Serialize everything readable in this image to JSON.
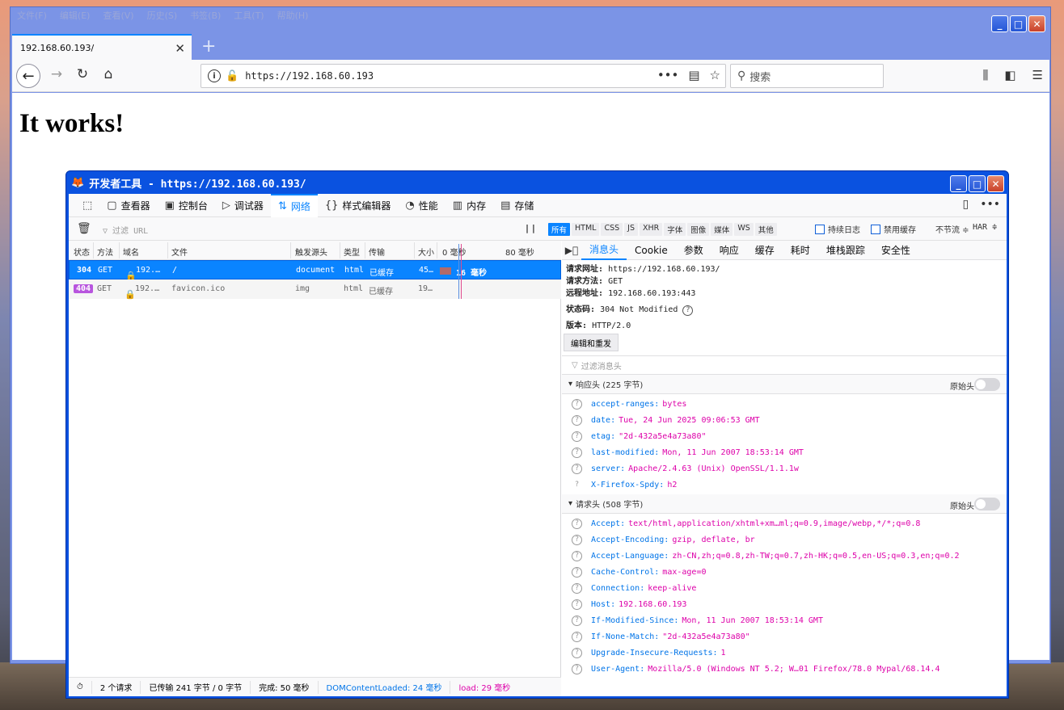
{
  "browser": {
    "menu": [
      "文件(F)",
      "编辑(E)",
      "查看(V)",
      "历史(S)",
      "书签(B)",
      "工具(T)",
      "帮助(H)"
    ],
    "tab_title": "192.168.60.193/",
    "url": "https://192.168.60.193",
    "search_placeholder": "搜索",
    "page_heading": "It works!"
  },
  "devtools": {
    "title": "开发者工具 - https://192.168.60.193/",
    "tabs": [
      {
        "label": "查看器",
        "icon": "inspector-icon"
      },
      {
        "label": "控制台",
        "icon": "console-icon"
      },
      {
        "label": "调试器",
        "icon": "debugger-icon"
      },
      {
        "label": "网络",
        "icon": "network-icon",
        "active": true
      },
      {
        "label": "样式编辑器",
        "icon": "style-editor-icon"
      },
      {
        "label": "性能",
        "icon": "performance-icon"
      },
      {
        "label": "内存",
        "icon": "memory-icon"
      },
      {
        "label": "存储",
        "icon": "storage-icon"
      }
    ],
    "filter_url": "过滤 URL",
    "type_filters": [
      "所有",
      "HTML",
      "CSS",
      "JS",
      "XHR",
      "字体",
      "图像",
      "媒体",
      "WS",
      "其他"
    ],
    "persist_log": "持续日志",
    "disable_cache": "禁用缓存",
    "throttle": "不节流 ≑",
    "har": "HAR ≑",
    "columns": [
      "状态",
      "方法",
      "域名",
      "文件",
      "触发源头",
      "类型",
      "传输",
      "大小",
      "0 毫秒",
      "80 毫秒"
    ],
    "requests": [
      {
        "status": "304",
        "method": "GET",
        "domain": "192.…",
        "file": "/",
        "cause": "document",
        "type": "html",
        "transferred": "已缓存",
        "size": "45…",
        "timing": "16 毫秒"
      },
      {
        "status": "404",
        "method": "GET",
        "domain": "192.…",
        "file": "favicon.ico",
        "cause": "img",
        "type": "html",
        "transferred": "已缓存",
        "size": "19…",
        "timing": ""
      }
    ],
    "status_bar": {
      "requests": "2 个请求",
      "transferred": "已传输 241 字节 / 0 字节",
      "finish": "完成: 50 毫秒",
      "dcl": "DOMContentLoaded: 24 毫秒",
      "load": "load: 29 毫秒"
    },
    "detail_tabs": [
      "消息头",
      "Cookie",
      "参数",
      "响应",
      "缓存",
      "耗时",
      "堆栈跟踪",
      "安全性"
    ],
    "summary": {
      "url_label": "请求网址:",
      "url": "https://192.168.60.193/",
      "method_label": "请求方法:",
      "method": "GET",
      "remote_label": "远程地址:",
      "remote": "192.168.60.193:443",
      "status_label": "状态码:",
      "status": "304 Not Modified",
      "version_label": "版本:",
      "version": "HTTP/2.0"
    },
    "resend_button": "编辑和重发",
    "filter_headers": "过滤消息头",
    "raw_label": "原始头",
    "response_headers_title": "响应头 (225 字节)",
    "response_headers": [
      {
        "k": "accept-ranges:",
        "v": "bytes"
      },
      {
        "k": "date:",
        "v": "Tue, 24 Jun 2025 09:06:53 GMT"
      },
      {
        "k": "etag:",
        "v": "\"2d-432a5e4a73a80\""
      },
      {
        "k": "last-modified:",
        "v": "Mon, 11 Jun 2007 18:53:14 GMT"
      },
      {
        "k": "server:",
        "v": "Apache/2.4.63 (Unix) OpenSSL/1.1.1w"
      },
      {
        "k": "X-Firefox-Spdy:",
        "v": "h2"
      }
    ],
    "request_headers_title": "请求头 (508 字节)",
    "request_headers": [
      {
        "k": "Accept:",
        "v": "text/html,application/xhtml+xm…ml;q=0.9,image/webp,*/*;q=0.8"
      },
      {
        "k": "Accept-Encoding:",
        "v": "gzip, deflate, br"
      },
      {
        "k": "Accept-Language:",
        "v": "zh-CN,zh;q=0.8,zh-TW;q=0.7,zh-HK;q=0.5,en-US;q=0.3,en;q=0.2"
      },
      {
        "k": "Cache-Control:",
        "v": "max-age=0"
      },
      {
        "k": "Connection:",
        "v": "keep-alive"
      },
      {
        "k": "Host:",
        "v": "192.168.60.193"
      },
      {
        "k": "If-Modified-Since:",
        "v": "Mon, 11 Jun 2007 18:53:14 GMT"
      },
      {
        "k": "If-None-Match:",
        "v": "\"2d-432a5e4a73a80\""
      },
      {
        "k": "Upgrade-Insecure-Requests:",
        "v": "1"
      },
      {
        "k": "User-Agent:",
        "v": "Mozilla/5.0 (Windows NT 5.2; W…01 Firefox/78.0 Mypal/68.14.4"
      }
    ]
  },
  "colors": {
    "accent": "#0a84ff",
    "title_bar": "#0a52e0",
    "header_value": "#dd00a9",
    "header_key": "#0074e8"
  }
}
